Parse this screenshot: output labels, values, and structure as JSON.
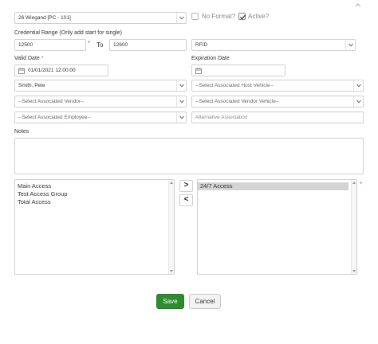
{
  "format_select": {
    "value": "26 Wiegand [PC - 101]"
  },
  "no_format": {
    "label": "No Format?",
    "checked": false
  },
  "active": {
    "label": "Active?",
    "checked": true
  },
  "credential_range": {
    "label": "Credential Range (Only add start for single)",
    "start": "12500",
    "to_label": "To",
    "end": "12600",
    "required_mark": "*"
  },
  "credential_type_select": {
    "value": "RFID"
  },
  "valid_date": {
    "label": "Valid Date",
    "required_mark": "*",
    "value": "01/01/2021 12:00:00"
  },
  "expiration_date": {
    "label": "Expiration Date",
    "value": ""
  },
  "person_select": {
    "value": "Smith, Pete"
  },
  "host_vehicle_select": {
    "value": "--Select Associated Host Vehicle--"
  },
  "vendor_select": {
    "value": "--Select Associated Vendor--"
  },
  "vendor_vehicle_select": {
    "value": "--Select Associated Vendor Vehicle--"
  },
  "employee_select": {
    "value": "--Select Associated Employee--"
  },
  "alternative_association": {
    "placeholder": "Alternative Association",
    "value": ""
  },
  "notes": {
    "label": "Notes",
    "value": ""
  },
  "available_access": {
    "items": [
      "Main Access",
      "Test Access Group",
      "Total Access"
    ]
  },
  "assigned_access": {
    "items": [
      "24/7 Access"
    ],
    "selected_index": 0,
    "required_mark": "*"
  },
  "move_right_label": ">",
  "move_left_label": "<",
  "buttons": {
    "save": "Save",
    "cancel": "Cancel"
  },
  "icons": {
    "collapse": "chevron-up-icon",
    "calendar": "calendar-icon",
    "dropdown": "chevron-down-icon"
  },
  "colors": {
    "save_button": "#2e8b2e",
    "required": "#d9534f",
    "selected_item": "#d4d4d4"
  }
}
